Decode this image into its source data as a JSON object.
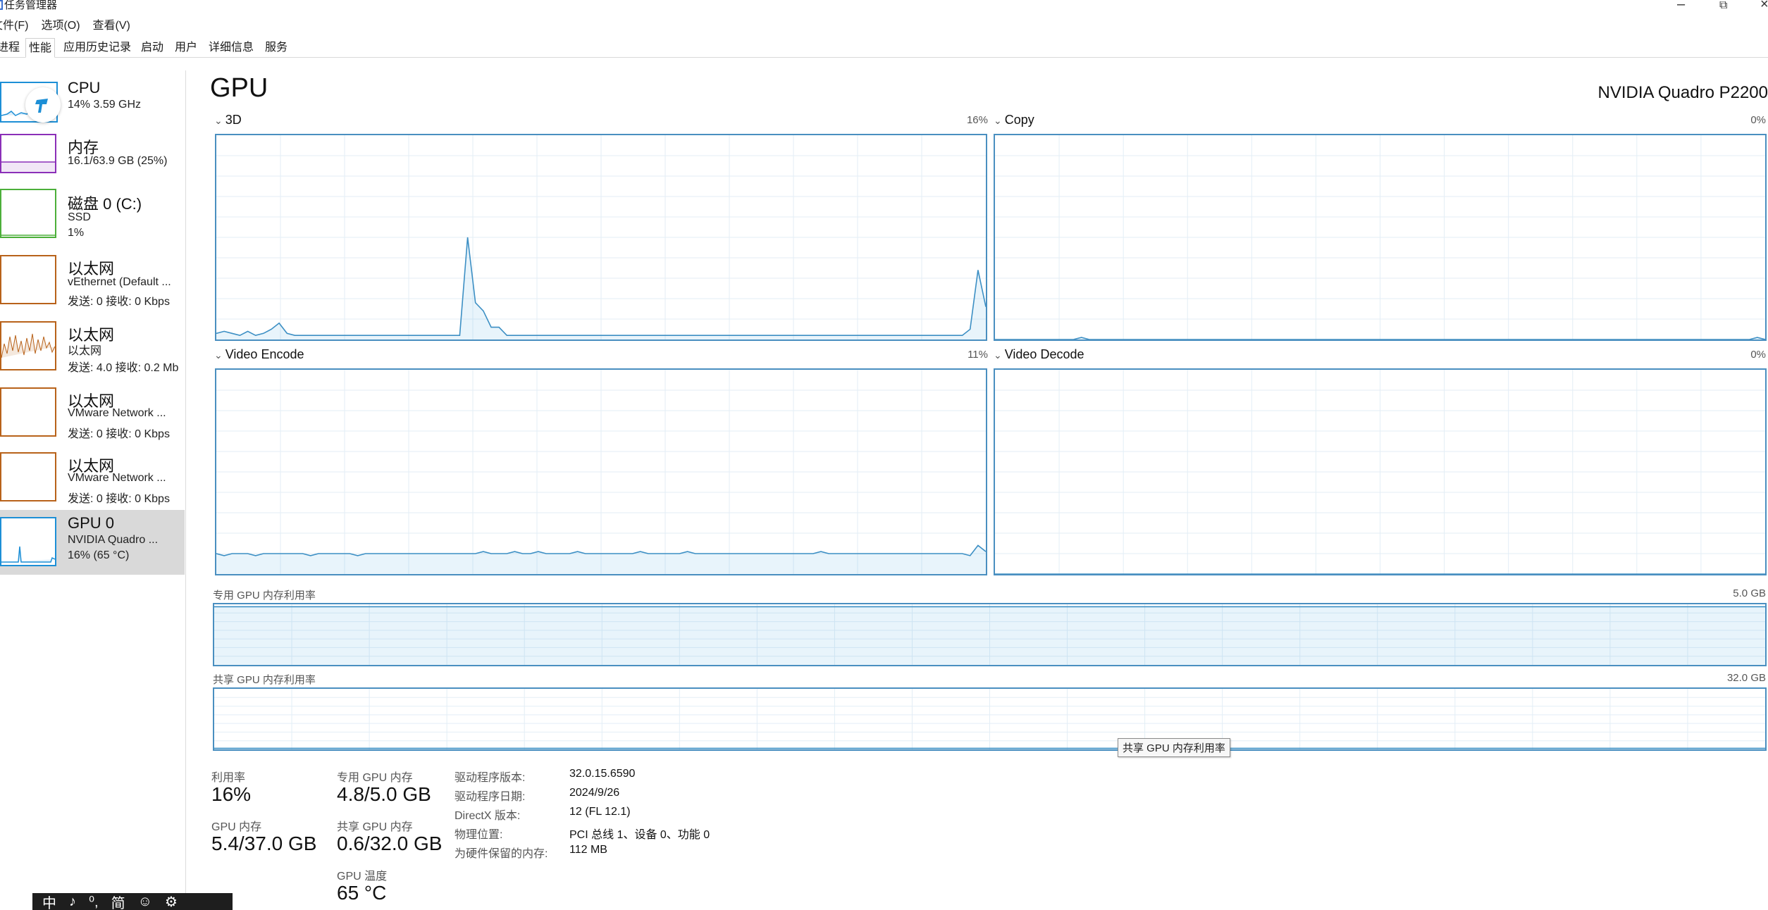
{
  "window": {
    "title": "任务管理器",
    "minimize_icon": "–",
    "restore_icon": "⧉",
    "close_icon": "×"
  },
  "menu": [
    "文件(F)",
    "选项(O)",
    "查看(V)"
  ],
  "tabs": [
    {
      "label": "进程",
      "active": false
    },
    {
      "label": "性能",
      "active": true
    },
    {
      "label": "应用历史记录",
      "active": false
    },
    {
      "label": "启动",
      "active": false
    },
    {
      "label": "用户",
      "active": false
    },
    {
      "label": "详细信息",
      "active": false
    },
    {
      "label": "服务",
      "active": false
    }
  ],
  "sidebar": [
    {
      "name": "CPU",
      "sub1": "14% 3.59 GHz",
      "sub2": "",
      "color": "#1d8fd6"
    },
    {
      "name": "内存",
      "sub1": "16.1/63.9 GB (25%)",
      "sub2": "",
      "color": "#8b2fb8"
    },
    {
      "name": "磁盘 0 (C:)",
      "sub1": "SSD",
      "sub2": "1%",
      "color": "#4caf3a"
    },
    {
      "name": "以太网",
      "sub1": "vEthernet (Default ...",
      "sub2": "发送: 0 接收: 0 Kbps",
      "color": "#b8621a"
    },
    {
      "name": "以太网",
      "sub1": "以太网",
      "sub2": "发送: 4.0 接收: 0.2 Mb",
      "color": "#b8621a"
    },
    {
      "name": "以太网",
      "sub1": "VMware Network ...",
      "sub2": "发送: 0 接收: 0 Kbps",
      "color": "#b8621a"
    },
    {
      "name": "以太网",
      "sub1": "VMware Network ...",
      "sub2": "发送: 0 接收: 0 Kbps",
      "color": "#b8621a"
    },
    {
      "name": "GPU 0",
      "sub1": "NVIDIA Quadro ...",
      "sub2": "16% (65 °C)",
      "color": "#1d8fd6",
      "selected": true
    }
  ],
  "main": {
    "title": "GPU",
    "model": "NVIDIA Quadro P2200",
    "engines": [
      {
        "label": "3D",
        "pct": "16%"
      },
      {
        "label": "Copy",
        "pct": "0%"
      },
      {
        "label": "Video Encode",
        "pct": "11%"
      },
      {
        "label": "Video Decode",
        "pct": "0%"
      }
    ],
    "dedicated_label": "专用 GPU 内存利用率",
    "dedicated_max": "5.0 GB",
    "shared_label": "共享 GPU 内存利用率",
    "shared_max": "32.0 GB",
    "tooltip": "共享 GPU 内存利用率"
  },
  "stats": {
    "utilization_label": "利用率",
    "utilization_value": "16%",
    "dedicated_label": "专用 GPU 内存",
    "dedicated_value": "4.8/5.0 GB",
    "gpu_mem_label": "GPU 内存",
    "gpu_mem_value": "5.4/37.0 GB",
    "shared_label": "共享 GPU 内存",
    "shared_value": "0.6/32.0 GB",
    "temp_label": "GPU 温度",
    "temp_value": "65 °C"
  },
  "info": [
    {
      "label": "驱动程序版本:",
      "value": "32.0.15.6590"
    },
    {
      "label": "驱动程序日期:",
      "value": "2024/9/26"
    },
    {
      "label": "DirectX 版本:",
      "value": "12 (FL 12.1)"
    },
    {
      "label": "物理位置:",
      "value": "PCI 总线 1、设备 0、功能 0"
    },
    {
      "label": "为硬件保留的内存:",
      "value": "112 MB"
    }
  ],
  "ime": [
    "中",
    "♪",
    "⁰,",
    "简",
    "☺",
    "⚙"
  ],
  "chart_data": [
    {
      "type": "area",
      "title": "3D",
      "ylim": [
        0,
        100
      ],
      "values": [
        3,
        4,
        3,
        2,
        4,
        2,
        3,
        5,
        8,
        3,
        2,
        2,
        2,
        2,
        2,
        2,
        2,
        2,
        2,
        2,
        2,
        2,
        2,
        2,
        2,
        2,
        2,
        2,
        2,
        2,
        2,
        2,
        50,
        18,
        14,
        6,
        6,
        2,
        2,
        2,
        2,
        2,
        2,
        2,
        2,
        2,
        2,
        2,
        2,
        2,
        2,
        2,
        2,
        2,
        2,
        2,
        2,
        2,
        2,
        2,
        2,
        2,
        2,
        2,
        2,
        2,
        2,
        2,
        2,
        2,
        2,
        2,
        2,
        2,
        2,
        2,
        2,
        2,
        2,
        2,
        2,
        2,
        2,
        2,
        2,
        2,
        2,
        2,
        2,
        2,
        2,
        2,
        2,
        2,
        2,
        2,
        5,
        34,
        16
      ]
    },
    {
      "type": "area",
      "title": "Copy",
      "ylim": [
        0,
        100
      ],
      "values": [
        0,
        0,
        0,
        0,
        0,
        0,
        0,
        0,
        0,
        0,
        0,
        1,
        0,
        0,
        0,
        0,
        0,
        0,
        0,
        0,
        0,
        0,
        0,
        0,
        0,
        0,
        0,
        0,
        0,
        0,
        0,
        0,
        0,
        0,
        0,
        0,
        0,
        0,
        0,
        0,
        0,
        0,
        0,
        0,
        0,
        0,
        0,
        0,
        0,
        0,
        0,
        0,
        0,
        0,
        0,
        0,
        0,
        0,
        0,
        0,
        0,
        0,
        0,
        0,
        0,
        0,
        0,
        0,
        0,
        0,
        0,
        0,
        0,
        0,
        0,
        0,
        0,
        0,
        0,
        0,
        0,
        0,
        0,
        0,
        0,
        0,
        0,
        0,
        0,
        0,
        0,
        0,
        0,
        0,
        0,
        0,
        0,
        1,
        0
      ]
    },
    {
      "type": "area",
      "title": "Video Encode",
      "ylim": [
        0,
        100
      ],
      "values": [
        10,
        9,
        10,
        10,
        10,
        9,
        10,
        10,
        10,
        10,
        10,
        10,
        9,
        10,
        10,
        10,
        10,
        10,
        9,
        10,
        10,
        10,
        10,
        10,
        10,
        10,
        10,
        10,
        10,
        10,
        10,
        10,
        10,
        10,
        11,
        10,
        10,
        10,
        11,
        10,
        10,
        11,
        10,
        10,
        10,
        10,
        11,
        10,
        10,
        10,
        10,
        10,
        10,
        10,
        11,
        10,
        10,
        10,
        10,
        10,
        11,
        10,
        10,
        10,
        10,
        10,
        10,
        10,
        10,
        10,
        10,
        10,
        10,
        10,
        10,
        10,
        10,
        11,
        10,
        10,
        10,
        10,
        10,
        10,
        10,
        10,
        10,
        10,
        10,
        10,
        10,
        10,
        10,
        10,
        10,
        10,
        9,
        14,
        11
      ]
    },
    {
      "type": "area",
      "title": "Video Decode",
      "ylim": [
        0,
        100
      ],
      "values": [
        0
      ]
    },
    {
      "type": "area",
      "title": "专用 GPU 内存利用率",
      "ylim": [
        0,
        5.0
      ],
      "values": [
        4.8
      ]
    },
    {
      "type": "area",
      "title": "共享 GPU 内存利用率",
      "ylim": [
        0,
        32.0
      ],
      "values": [
        0.6
      ]
    }
  ]
}
